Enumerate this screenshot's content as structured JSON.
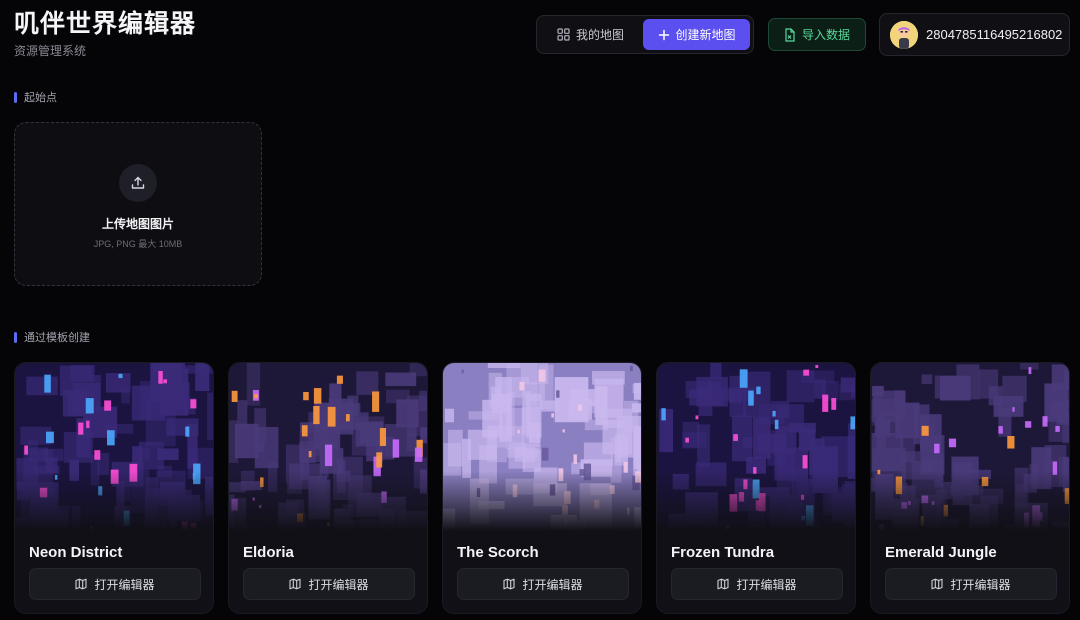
{
  "brand": {
    "title": "叽伴世界编辑器",
    "subtitle": "资源管理系统"
  },
  "header": {
    "my_maps_label": "我的地图",
    "create_map_label": "创建新地图",
    "import_label": "导入数据",
    "user_id": "2804785116495216802"
  },
  "colors": {
    "accent": "#5b4ff0",
    "import_green": "#58d79b",
    "section_bar": "#5b6cf5"
  },
  "sections": {
    "start": "起始点",
    "templates": "通过模板创建"
  },
  "upload": {
    "title": "上传地图图片",
    "hint": "JPG, PNG 最大 10MB"
  },
  "templates": [
    {
      "name": "Neon District",
      "button": "打开编辑器",
      "palette": [
        "#1b1440",
        "#3a2a78",
        "#ff4fd8",
        "#4aa8ff"
      ]
    },
    {
      "name": "Eldoria",
      "button": "打开编辑器",
      "palette": [
        "#1e1838",
        "#4a3a7a",
        "#ff9a3c",
        "#c86bff"
      ]
    },
    {
      "name": "The Scorch",
      "button": "打开编辑器",
      "palette": [
        "#8a7fc0",
        "#c9b8ee",
        "#f1c6e6",
        "#6a5c9e"
      ]
    },
    {
      "name": "Frozen Tundra",
      "button": "打开编辑器",
      "palette": [
        "#1b1440",
        "#3a2a78",
        "#ff4fd8",
        "#4aa8ff"
      ]
    },
    {
      "name": "Emerald Jungle",
      "button": "打开编辑器",
      "palette": [
        "#1e1838",
        "#4a3a7a",
        "#ff9a3c",
        "#c86bff"
      ]
    }
  ]
}
